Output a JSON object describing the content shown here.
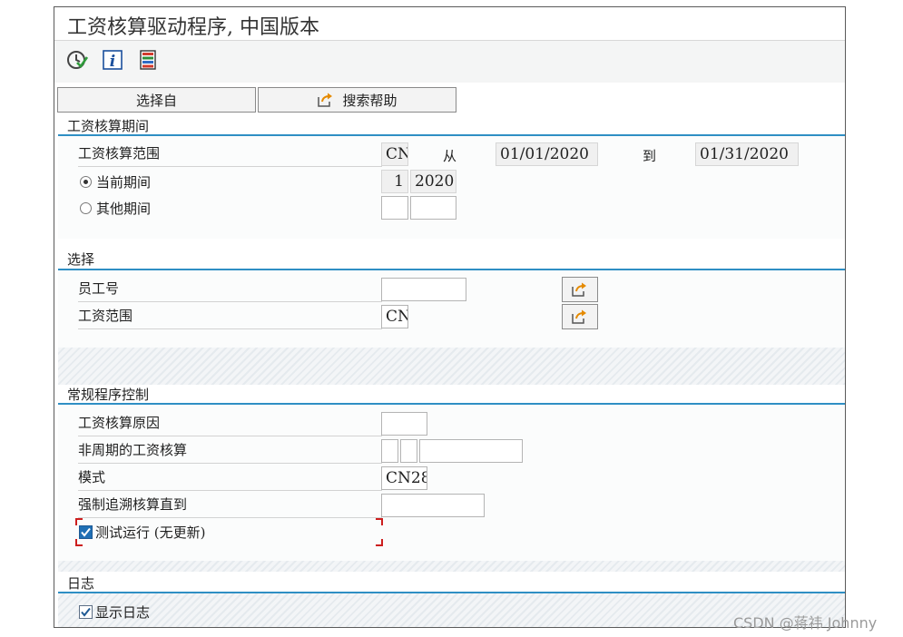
{
  "title": "工资核算驱动程序, 中国版本",
  "toolbar": {
    "icons": [
      "execute-icon",
      "info-icon",
      "variants-icon"
    ]
  },
  "buttons": {
    "select_from": "选择自",
    "search_help": "搜索帮助"
  },
  "period_section": {
    "header": "工资核算期间",
    "payroll_area_label": "工资核算范围",
    "payroll_area_value": "CN",
    "from_label": "从",
    "from_date": "01/01/2020",
    "to_label": "到",
    "to_date": "01/31/2020",
    "current_period_label": "当前期间",
    "current_period_number": "1",
    "current_period_year": "2020",
    "other_period_label": "其他期间",
    "selected_option": "current"
  },
  "selection_section": {
    "header": "选择",
    "personnel_number_label": "员工号",
    "personnel_number_value": "",
    "payroll_area_label": "工资范围",
    "payroll_area_value": "CN"
  },
  "control_section": {
    "header": "常规程序控制",
    "reason_label": "工资核算原因",
    "offcycle_label": "非周期的工资核算",
    "schema_label": "模式",
    "schema_value": "CN28",
    "forced_retro_label": "强制追溯核算直到",
    "test_run_label": "测试运行 (无更新)",
    "test_run_checked": true
  },
  "log_section": {
    "header": "日志",
    "display_log_label": "显示日志",
    "display_log_checked": true
  },
  "watermark": "CSDN @蒋祎 Johnny",
  "colors": {
    "section_line": "#2f8fc4",
    "focus_corner": "#cc1e1e",
    "checkbox_fill": "#1f6fb5"
  }
}
